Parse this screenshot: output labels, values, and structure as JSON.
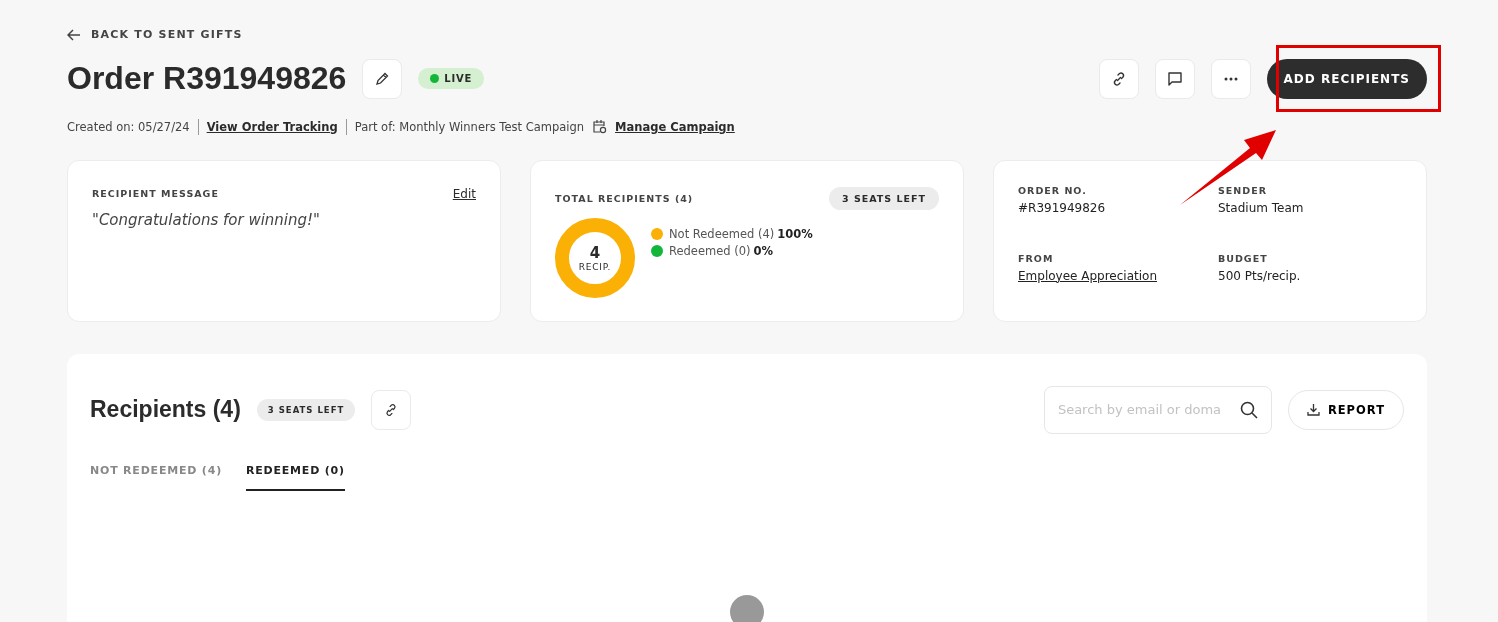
{
  "back_link": "BACK TO SENT GIFTS",
  "order": {
    "title": "Order R391949826",
    "status": {
      "label": "LIVE",
      "live": true
    }
  },
  "meta": {
    "created": "Created on: 05/27/24",
    "tracking_link": "View Order Tracking",
    "part_of": "Part of: Monthly Winners Test Campaign",
    "campaign_link": "Manage Campaign"
  },
  "actions": {
    "primary": "ADD RECIPIENTS",
    "highlighted": true
  },
  "message_card": {
    "label": "RECIPIENT MESSAGE",
    "edit": "Edit",
    "message": "\"Congratulations for winning!\""
  },
  "recipients_card": {
    "label": "TOTAL RECIPIENTS (4)",
    "seats": "3 SEATS LEFT",
    "count": "4",
    "unit": "RECIP.",
    "legend": [
      {
        "label": "Not Redeemed (4)",
        "percent": "100%",
        "color": "#fab005"
      },
      {
        "label": "Redeemed (0)",
        "percent": "0%",
        "color": "#12b73a"
      }
    ]
  },
  "details_card": {
    "fields": [
      {
        "label": "ORDER NO.",
        "value": "#R391949826",
        "link": false
      },
      {
        "label": "SENDER",
        "value": "Stadium Team",
        "link": false
      },
      {
        "label": "FROM",
        "value": "Employee Appreciation",
        "link": true
      },
      {
        "label": "BUDGET",
        "value": "500 Pts/recip.",
        "link": false
      }
    ]
  },
  "recipients": {
    "title": "Recipients (4)",
    "seats": "3 SEATS LEFT",
    "search": {
      "placeholder": "Search by email or doma"
    },
    "report": "REPORT",
    "tabs": [
      {
        "label": "NOT REDEEMED (4)",
        "selected": false
      },
      {
        "label": "REDEEMED (0)",
        "selected": true
      }
    ],
    "loading": true
  }
}
